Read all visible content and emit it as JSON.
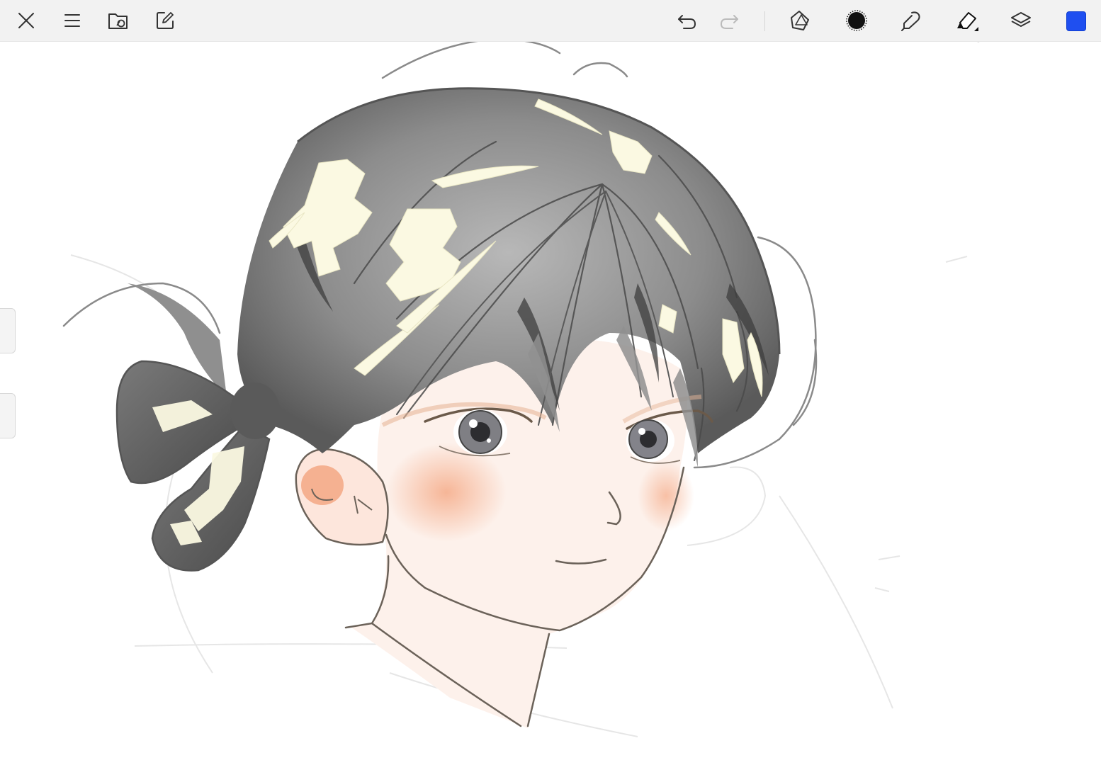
{
  "app": {
    "accent_color": "#1f4ff0"
  },
  "toolbar": {
    "left_tools": [
      {
        "name": "close",
        "icon": "close-icon"
      },
      {
        "name": "menu",
        "icon": "menu-icon"
      },
      {
        "name": "gallery",
        "icon": "folder-icon"
      },
      {
        "name": "actions",
        "icon": "edit-share-icon"
      }
    ],
    "history": [
      {
        "name": "undo",
        "icon": "undo-icon",
        "enabled": true
      },
      {
        "name": "redo",
        "icon": "redo-icon",
        "enabled": false
      }
    ],
    "right_tools": [
      {
        "name": "shapes",
        "icon": "shapes-icon"
      },
      {
        "name": "brush",
        "icon": "brush-icon"
      },
      {
        "name": "smudge",
        "icon": "smudge-icon"
      },
      {
        "name": "eraser",
        "icon": "eraser-icon"
      },
      {
        "name": "layers",
        "icon": "layers-icon"
      }
    ],
    "current_color": "#1f4ff0"
  },
  "canvas": {
    "content": "sketch-illustration",
    "colors": {
      "hair": "#8a8a8a",
      "hair_dark": "#4a4a4a",
      "highlight": "#fbf9e6",
      "skin": "#fdf0ea",
      "blush": "#f6b79a",
      "line": "#6a6a6a",
      "sketch": "#e6e6e6"
    }
  },
  "side_panel": {
    "handles": [
      "brush-size-slider",
      "opacity-slider"
    ]
  }
}
